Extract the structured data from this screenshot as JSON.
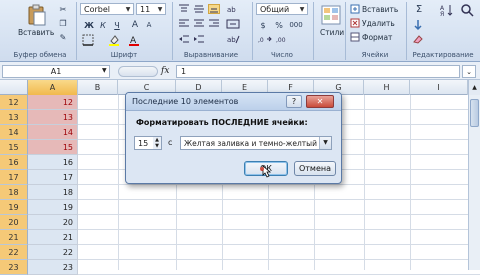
{
  "ribbon": {
    "clipboard": {
      "paste_label": "Вставить",
      "group_label": "Буфер обмена"
    },
    "font": {
      "name": "Corbel",
      "size": "11",
      "bold": "Ж",
      "italic": "К",
      "underline": "Ч",
      "grow": "A",
      "shrink": "A",
      "group_label": "Шрифт"
    },
    "alignment": {
      "group_label": "Выравнивание"
    },
    "number": {
      "format": "Общий",
      "percent": "%",
      "thousands": "000",
      "group_label": "Число"
    },
    "styles": {
      "label": "Стили"
    },
    "cells": {
      "insert": "Вставить",
      "delete": "Удалить",
      "format": "Формат",
      "group_label": "Ячейки"
    },
    "editing": {
      "sigma": "Σ",
      "group_label": "Редактирование"
    }
  },
  "formula_bar": {
    "name_box": "A1",
    "fx": "fx",
    "value": "1"
  },
  "columns": [
    "A",
    "B",
    "C",
    "D",
    "E",
    "F",
    "G",
    "H",
    "I"
  ],
  "rows": [
    {
      "num": "12",
      "value": "12",
      "highlight": true
    },
    {
      "num": "13",
      "value": "13",
      "highlight": true
    },
    {
      "num": "14",
      "value": "14",
      "highlight": true
    },
    {
      "num": "15",
      "value": "15",
      "highlight": true
    },
    {
      "num": "16",
      "value": "16",
      "highlight": false
    },
    {
      "num": "17",
      "value": "17",
      "highlight": false
    },
    {
      "num": "18",
      "value": "18",
      "highlight": false
    },
    {
      "num": "19",
      "value": "19",
      "highlight": false
    },
    {
      "num": "20",
      "value": "20",
      "highlight": false
    },
    {
      "num": "21",
      "value": "21",
      "highlight": false
    },
    {
      "num": "22",
      "value": "22",
      "highlight": false
    },
    {
      "num": "23",
      "value": "23",
      "highlight": false
    }
  ],
  "dialog": {
    "title": "Последние 10 элементов",
    "help": "?",
    "close": "✕",
    "prompt": "Форматировать ПОСЛЕДНИЕ ячейки:",
    "count": "15",
    "conj": "с",
    "format_option": "Желтая заливка и темно-желтый текст",
    "ok": "ОК",
    "cancel": "Отмена"
  },
  "colors": {
    "highlight_fill": "#e6b9b8",
    "highlight_text": "#9c0006",
    "row_header_selected": "#f5c977"
  }
}
